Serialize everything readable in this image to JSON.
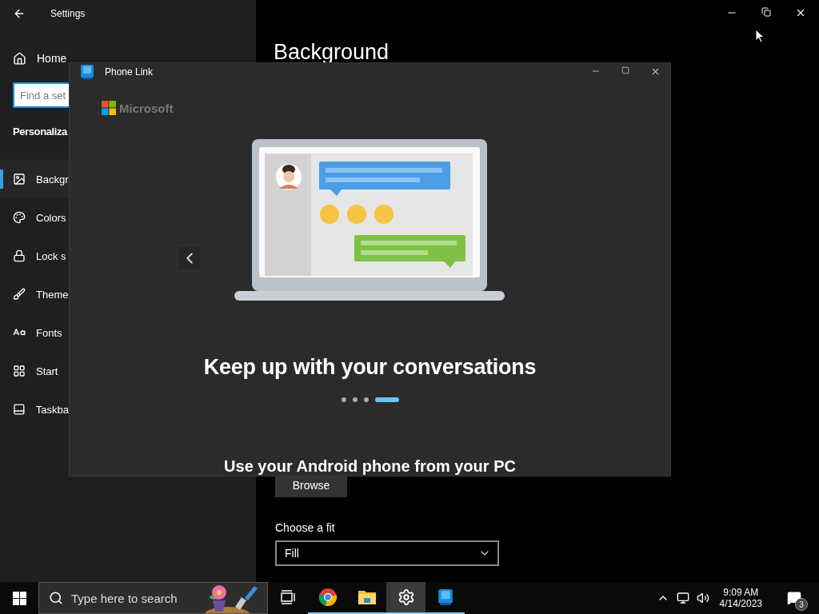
{
  "settings_window": {
    "title": "Settings",
    "sidebar": {
      "home": "Home",
      "search": {
        "placeholder": "Find a set"
      },
      "section": "Personaliza",
      "items": [
        {
          "label": "Backgr",
          "selected": true
        },
        {
          "label": "Colors",
          "selected": false
        },
        {
          "label": "Lock s",
          "selected": false
        },
        {
          "label": "Theme",
          "selected": false
        },
        {
          "label": "Fonts",
          "selected": false
        },
        {
          "label": "Start",
          "selected": false
        },
        {
          "label": "Taskba",
          "selected": false
        }
      ]
    },
    "content": {
      "heading": "Background",
      "browse_button": "Browse",
      "fit_label": "Choose a fit",
      "fit_value": "Fill"
    }
  },
  "phone_link_window": {
    "title": "Phone Link",
    "brand": "Microsoft",
    "slide_title": "Keep up with your conversations",
    "subtitle": "Use your Android phone from your PC",
    "pages": [
      {
        "selected": false
      },
      {
        "selected": false
      },
      {
        "selected": false
      },
      {
        "selected": true
      }
    ]
  },
  "taskbar": {
    "search": {
      "placeholder": "Type here to search"
    },
    "apps": [
      {
        "kind": "taskview",
        "open": false,
        "selected": false
      },
      {
        "kind": "browser",
        "open": true,
        "selected": false
      },
      {
        "kind": "folder",
        "open": true,
        "selected": false
      },
      {
        "kind": "settings",
        "open": true,
        "selected": true
      },
      {
        "kind": "phone",
        "open": true,
        "selected": false
      }
    ],
    "time": "9:09 AM",
    "date": "4/14/2023",
    "notification_count": "3"
  }
}
